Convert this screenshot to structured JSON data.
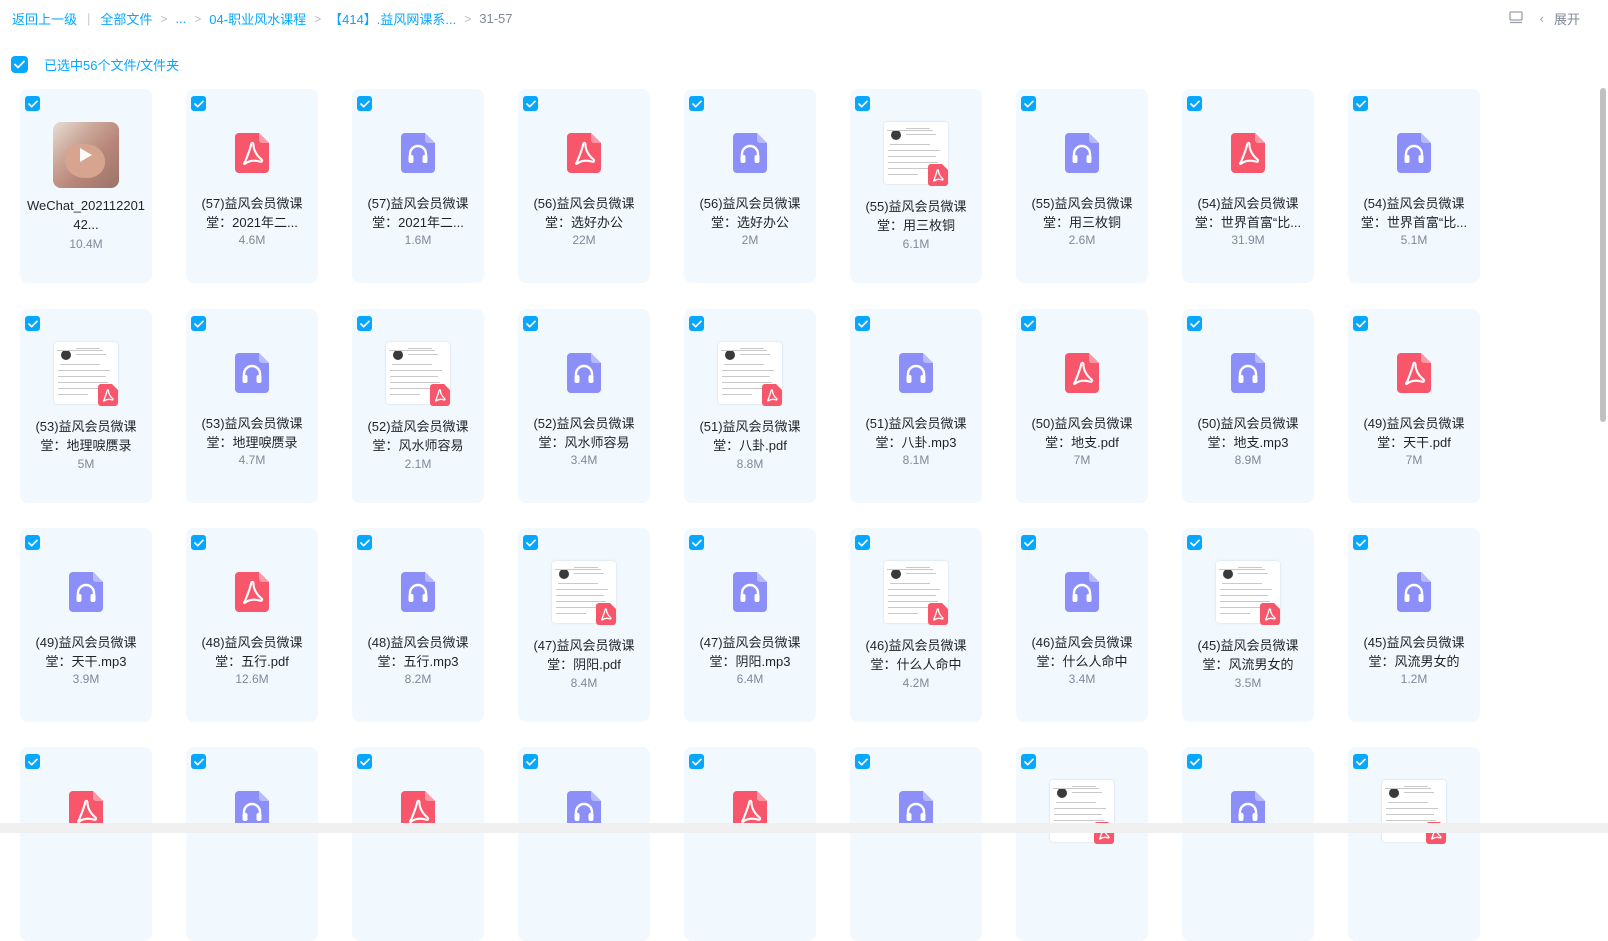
{
  "breadcrumb": {
    "back": "返回上一级",
    "all_files": "全部文件",
    "ellipsis": "...",
    "folder1": "04-职业风水课程",
    "folder2": "【414】.益风网课系...",
    "current": "31-57"
  },
  "toolbar": {
    "expand_label": "展开"
  },
  "selection": {
    "text": "已选中56个文件/文件夹"
  },
  "colors": {
    "accent": "#06a7ff",
    "pdf": "#f8566b",
    "audio": "#8b8ff7",
    "card_bg": "#f1f8fe"
  },
  "files": [
    {
      "name": "WeChat_20211220142...",
      "size": "10.4M",
      "type": "video"
    },
    {
      "name": "(57)益风会员微课堂：2021年二...",
      "size": "4.6M",
      "type": "pdf"
    },
    {
      "name": "(57)益风会员微课堂：2021年二...",
      "size": "1.6M",
      "type": "audio"
    },
    {
      "name": "(56)益风会员微课堂：选好办公",
      "size": "22M",
      "type": "pdf"
    },
    {
      "name": "(56)益风会员微课堂：选好办公",
      "size": "2M",
      "type": "audio"
    },
    {
      "name": "(55)益风会员微课堂：用三枚铜",
      "size": "6.1M",
      "type": "pdf-thumb"
    },
    {
      "name": "(55)益风会员微课堂：用三枚铜",
      "size": "2.6M",
      "type": "audio"
    },
    {
      "name": "(54)益风会员微课堂：世界首富“比...",
      "size": "31.9M",
      "type": "pdf"
    },
    {
      "name": "(54)益风会员微课堂：世界首富“比...",
      "size": "5.1M",
      "type": "audio"
    },
    {
      "name": "(53)益风会员微课堂：地理唳赝录",
      "size": "5M",
      "type": "pdf-thumb"
    },
    {
      "name": "(53)益风会员微课堂：地理唳赝录",
      "size": "4.7M",
      "type": "audio"
    },
    {
      "name": "(52)益风会员微课堂：风水师容易",
      "size": "2.1M",
      "type": "pdf-thumb"
    },
    {
      "name": "(52)益风会员微课堂：风水师容易",
      "size": "3.4M",
      "type": "audio"
    },
    {
      "name": "(51)益风会员微课堂：八卦.pdf",
      "size": "8.8M",
      "type": "pdf-thumb"
    },
    {
      "name": "(51)益风会员微课堂：八卦.mp3",
      "size": "8.1M",
      "type": "audio"
    },
    {
      "name": "(50)益风会员微课堂：地支.pdf",
      "size": "7M",
      "type": "pdf"
    },
    {
      "name": "(50)益风会员微课堂：地支.mp3",
      "size": "8.9M",
      "type": "audio"
    },
    {
      "name": "(49)益风会员微课堂：天干.pdf",
      "size": "7M",
      "type": "pdf"
    },
    {
      "name": "(49)益风会员微课堂：天干.mp3",
      "size": "3.9M",
      "type": "audio"
    },
    {
      "name": "(48)益风会员微课堂：五行.pdf",
      "size": "12.6M",
      "type": "pdf"
    },
    {
      "name": "(48)益风会员微课堂：五行.mp3",
      "size": "8.2M",
      "type": "audio"
    },
    {
      "name": "(47)益风会员微课堂：阴阳.pdf",
      "size": "8.4M",
      "type": "pdf-thumb"
    },
    {
      "name": "(47)益风会员微课堂：阴阳.mp3",
      "size": "6.4M",
      "type": "audio"
    },
    {
      "name": "(46)益风会员微课堂：什么人命中",
      "size": "4.2M",
      "type": "pdf-thumb"
    },
    {
      "name": "(46)益风会员微课堂：什么人命中",
      "size": "3.4M",
      "type": "audio"
    },
    {
      "name": "(45)益风会员微课堂：风流男女的",
      "size": "3.5M",
      "type": "pdf-thumb"
    },
    {
      "name": "(45)益风会员微课堂：风流男女的",
      "size": "1.2M",
      "type": "audio"
    },
    {
      "name": "",
      "size": "",
      "type": "pdf"
    },
    {
      "name": "",
      "size": "",
      "type": "audio"
    },
    {
      "name": "",
      "size": "",
      "type": "pdf"
    },
    {
      "name": "",
      "size": "",
      "type": "audio"
    },
    {
      "name": "",
      "size": "",
      "type": "pdf"
    },
    {
      "name": "",
      "size": "",
      "type": "audio"
    },
    {
      "name": "",
      "size": "",
      "type": "pdf-thumb"
    },
    {
      "name": "",
      "size": "",
      "type": "audio"
    },
    {
      "name": "",
      "size": "",
      "type": "pdf-thumb"
    }
  ]
}
